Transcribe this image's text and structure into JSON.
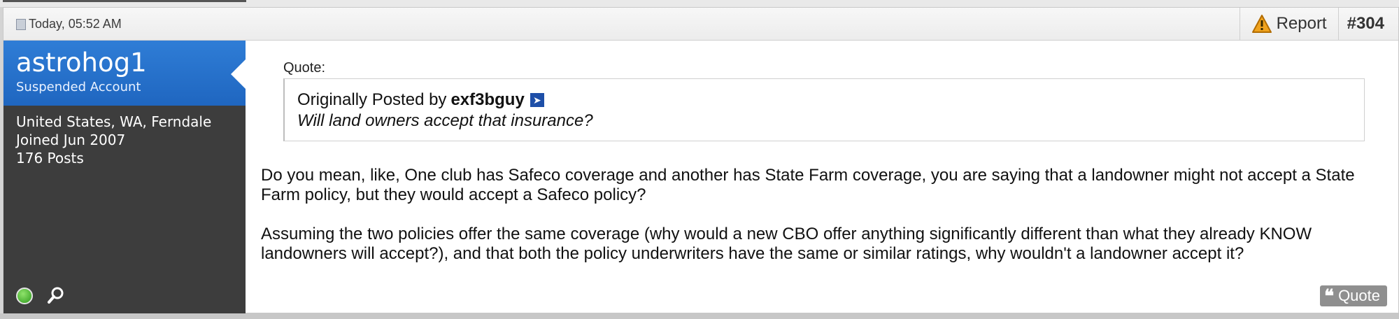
{
  "post": {
    "date": "Today, 05:52 AM",
    "report_label": "Report",
    "post_number": "#304",
    "user": {
      "name": "astrohog1",
      "title": "Suspended Account",
      "location": "United States, WA, Ferndale",
      "joined": "Joined Jun 2007",
      "posts": "176 Posts",
      "status_color": "#2e9a1c"
    },
    "quote": {
      "label": "Quote:",
      "originally_posted_by": "Originally Posted by",
      "author": "exf3bguy",
      "text": "Will land owners accept that insurance?"
    },
    "message": [
      "Do you mean, like, One club has Safeco coverage and another has State Farm coverage, you are saying that a landowner might not accept a State Farm policy, but they would accept a Safeco policy?",
      "Assuming the two policies offer the same coverage (why would a new CBO offer anything significantly different than what they already KNOW landowners will accept?), and that both the policy underwriters have the same or similar ratings, why wouldn't a landowner accept it?"
    ],
    "quote_button_label": "Quote"
  },
  "icons": {
    "date": "document-icon",
    "report": "warning-icon",
    "view_post": "arrow-right-icon",
    "online": "online-status-icon",
    "search": "search-icon",
    "quote_button": "quote-mark-icon"
  },
  "colors": {
    "user_header": "#1f66c0",
    "sidebar": "#3d3d3d",
    "quote_button": "#8f8f8f"
  }
}
